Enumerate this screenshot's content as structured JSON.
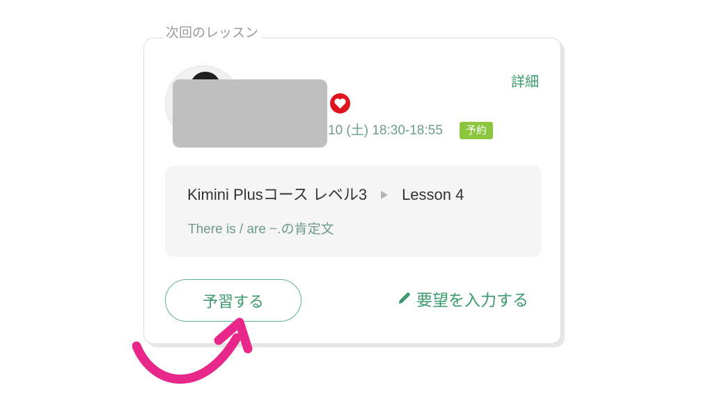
{
  "card": {
    "legend": "次回のレッスン",
    "detail_link": "詳細",
    "time_text": "10 (土) 18:30-18:55",
    "status_badge": "予約"
  },
  "course": {
    "name": "Kimini Plusコース レベル3",
    "lesson": "Lesson 4",
    "description": "There is / are ~.の肯定文"
  },
  "actions": {
    "preview_button": "予習する",
    "request_link": "要望を入力する"
  },
  "colors": {
    "accent_green": "#3c9a6e",
    "badge_green": "#8cc63e",
    "favorite_red": "#e0141f",
    "annotation_pink": "#e8278a"
  },
  "icons": [
    "heart-icon",
    "triangle-right-icon",
    "pencil-icon",
    "curved-arrow-icon"
  ]
}
